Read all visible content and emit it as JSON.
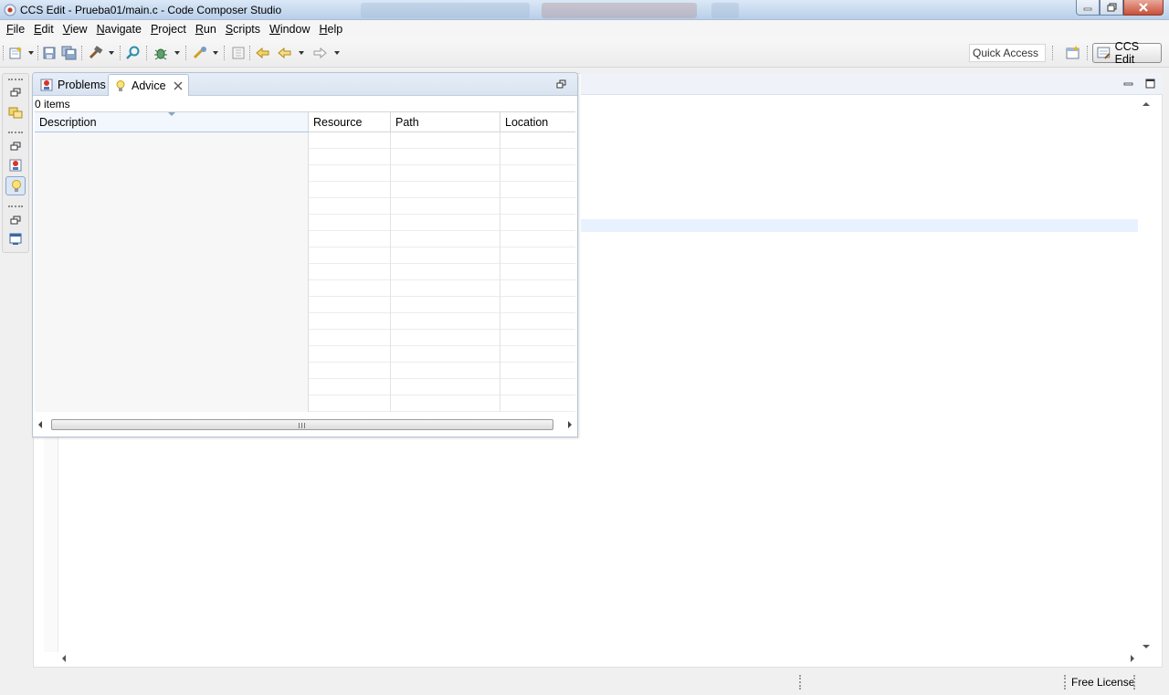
{
  "window": {
    "title": "CCS Edit - Prueba01/main.c - Code Composer Studio"
  },
  "menu": {
    "items": [
      {
        "label": "File",
        "key": "F",
        "rest": "ile"
      },
      {
        "label": "Edit",
        "key": "E",
        "rest": "dit"
      },
      {
        "label": "View",
        "key": "V",
        "rest": "iew"
      },
      {
        "label": "Navigate",
        "key": "N",
        "rest": "avigate"
      },
      {
        "label": "Project",
        "key": "P",
        "rest": "roject"
      },
      {
        "label": "Run",
        "key": "R",
        "rest": "un"
      },
      {
        "label": "Scripts",
        "key": "S",
        "rest": "cripts"
      },
      {
        "label": "Window",
        "key": "W",
        "rest": "indow"
      },
      {
        "label": "Help",
        "key": "H",
        "rest": "elp"
      }
    ]
  },
  "toolbar": {
    "quick_access": "Quick Access",
    "perspective": "CCS Edit",
    "icons": [
      "new-icon",
      "save-icon",
      "save-all-icon",
      "build-hammer-icon",
      "search-icon",
      "debug-bug-icon",
      "flash-icon",
      "grid-icon",
      "last-edit-icon",
      "back-arrow-icon",
      "forward-arrow-icon",
      "open-perspective-icon"
    ]
  },
  "view": {
    "tabs": [
      {
        "label": "Problems",
        "icon": "problems-icon",
        "active": false
      },
      {
        "label": "Advice",
        "icon": "lightbulb-icon",
        "active": true
      }
    ],
    "item_count": "0 items",
    "columns": [
      "Description",
      "Resource",
      "Path",
      "Location"
    ],
    "rows": []
  },
  "statusbar": {
    "license": "Free License"
  },
  "colors": {
    "title_gradient": "#c6d9ef",
    "tab_bg": "#e7eef8",
    "editor_highlight": "#e8f2fe"
  }
}
